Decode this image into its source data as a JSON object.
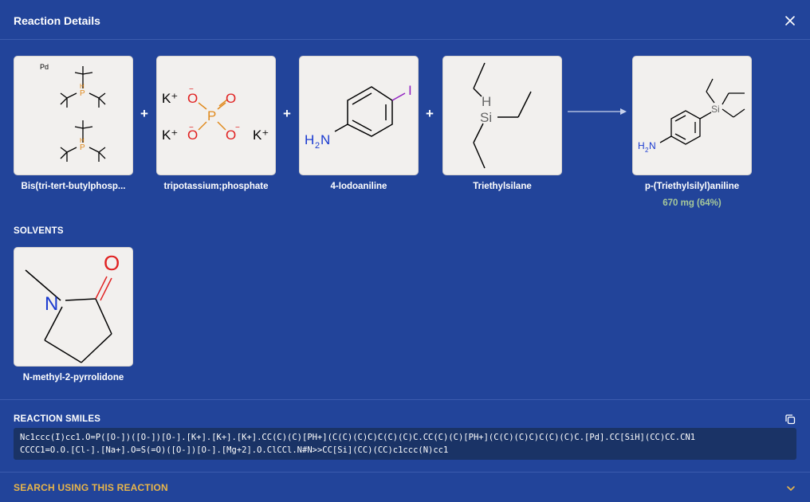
{
  "title": "Reaction Details",
  "reactants": [
    {
      "name": "Bis(tri-tert-butylphosp...",
      "icon": "bis-tri-tert-butylphosphine-palladium-structure"
    },
    {
      "name": "tripotassium;phosphate",
      "icon": "tripotassium-phosphate-structure"
    },
    {
      "name": "4-Iodoaniline",
      "icon": "4-iodoaniline-structure"
    },
    {
      "name": "Triethylsilane",
      "icon": "triethylsilane-structure"
    }
  ],
  "product": {
    "name": "p-(Triethylsilyl)aniline",
    "yield": "670 mg (64%)",
    "icon": "p-triethylsilyl-aniline-structure"
  },
  "plus": "+",
  "solvents_label": "SOLVENTS",
  "solvents": [
    {
      "name": "N-methyl-2-pyrrolidone",
      "icon": "n-methyl-2-pyrrolidone-structure"
    }
  ],
  "smiles_label": "REACTION SMILES",
  "smiles": "Nc1ccc(I)cc1.O=P([O-])([O-])[O-].[K+].[K+].[K+].CC(C)(C)[PH+](C(C)(C)C)C(C)(C)C.CC(C)(C)[PH+](C(C)(C)C)C(C)(C)C.[Pd].CC[SiH](CC)CC.CN1\nCCCC1=O.O.[Cl-].[Na+].O=S(=O)([O-])[O-].[Mg+2].O.ClCCl.N#N>>CC[Si](CC)(CC)c1ccc(N)cc1",
  "search_label": "SEARCH USING THIS REACTION",
  "colors": {
    "background": "#22449a",
    "accent": "#e8b54a",
    "yield": "#a6c89a",
    "smiles_bg": "#1a3366"
  },
  "icons": {
    "close": "close-icon",
    "copy": "copy-icon",
    "expand": "chevron-down-icon"
  }
}
